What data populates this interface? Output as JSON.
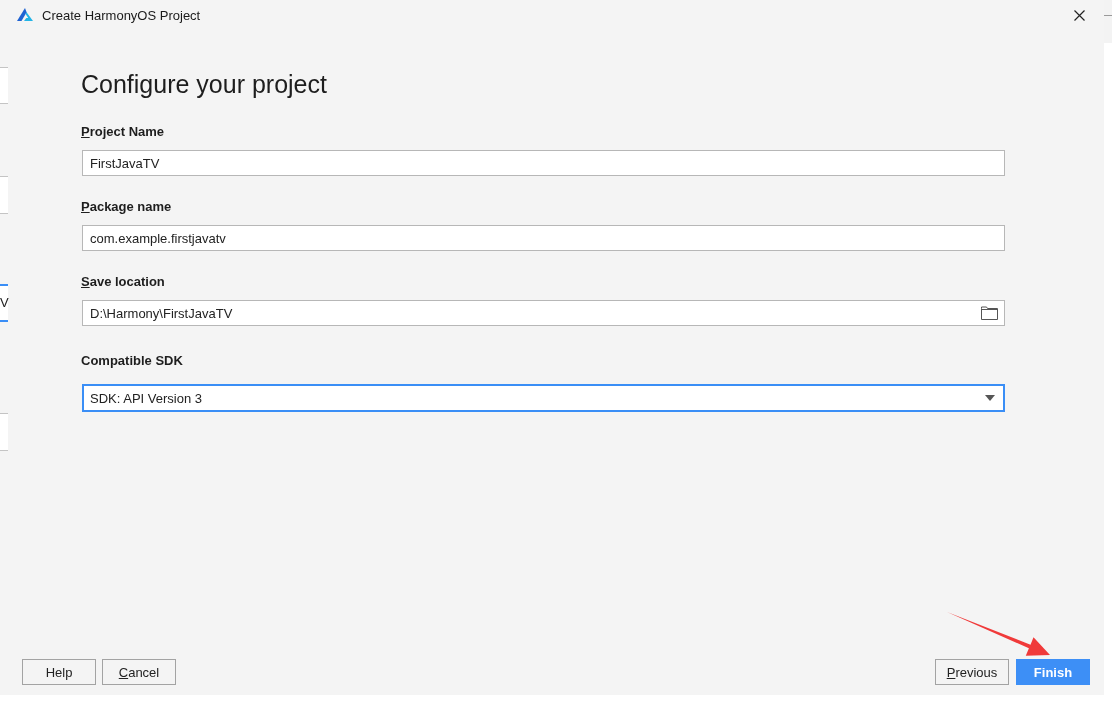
{
  "window": {
    "title": "Create HarmonyOS Project"
  },
  "background_window": {
    "text": "V"
  },
  "heading": "Configure your project",
  "fields": [
    {
      "kind": "text",
      "label": "Project Name",
      "mnemonic": true,
      "value": "FirstJavaTV",
      "focused": false
    },
    {
      "kind": "text",
      "label": "Package name",
      "mnemonic": true,
      "value": "com.example.firstjavatv",
      "focused": false
    },
    {
      "kind": "folder",
      "label": "Save location",
      "mnemonic": true,
      "value": "D:\\Harmony\\FirstJavaTV",
      "focused": false
    },
    {
      "kind": "dropdown",
      "label": "Compatible SDK",
      "mnemonic": false,
      "value": "SDK: API Version 3",
      "focused": true
    }
  ],
  "buttons_left": [
    {
      "label": "Help",
      "mnemonic": false,
      "kind": "default"
    },
    {
      "label": "Cancel",
      "mnemonic": true,
      "kind": "default"
    }
  ],
  "buttons_right": [
    {
      "label": "Previous",
      "mnemonic": true,
      "kind": "default"
    },
    {
      "label": "Finish",
      "mnemonic": false,
      "kind": "primary"
    }
  ]
}
